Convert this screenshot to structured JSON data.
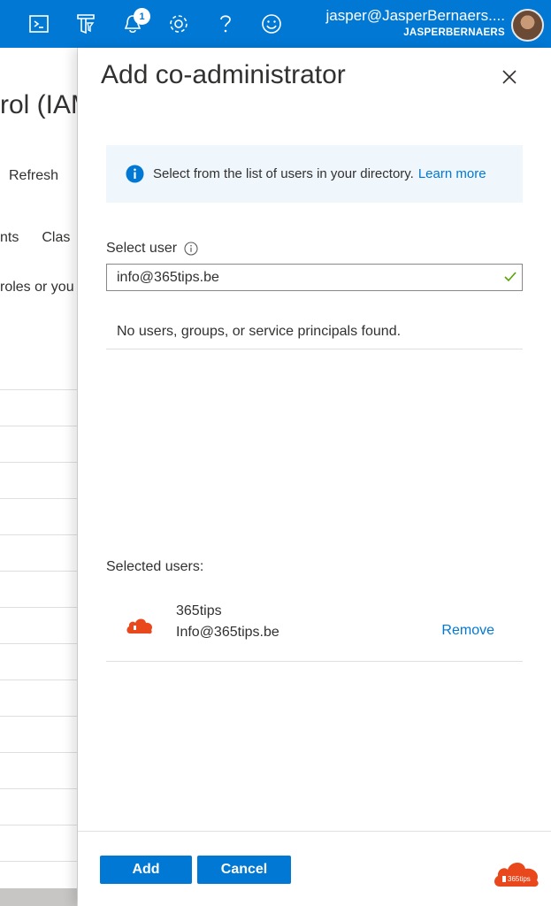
{
  "topbar": {
    "notification_count": "1",
    "account_email": "jasper@JasperBernaers....",
    "account_tenant": "JASPERBERNAERS",
    "icons": [
      "cloud-shell-icon",
      "directory-filter-icon",
      "notification-bell-icon",
      "settings-gear-icon",
      "help-icon",
      "feedback-smiley-icon"
    ]
  },
  "background": {
    "title_fragment": "rol (IAM",
    "refresh_label": "Refresh",
    "tab_1": "nts",
    "tab_2": "Clas",
    "sub_text": "roles or you"
  },
  "panel": {
    "title": "Add co-administrator",
    "info": {
      "text": "Select from the list of users in your directory.",
      "link": "Learn more"
    },
    "select_user_label": "Select user",
    "select_user_value": "info@365tips.be",
    "no_results": "No users, groups, or service principals found.",
    "selected_users_label": "Selected users:",
    "selected_users": [
      {
        "name": "365tips",
        "email": "Info@365tips.be",
        "remove_label": "Remove"
      }
    ],
    "add_button": "Add",
    "cancel_button": "Cancel"
  },
  "watermark": {
    "brand": "365tips"
  },
  "colors": {
    "accent": "#0078d4",
    "info_bg": "#eff6fc",
    "logo_orange": "#e8481c",
    "success_green": "#57a300"
  }
}
